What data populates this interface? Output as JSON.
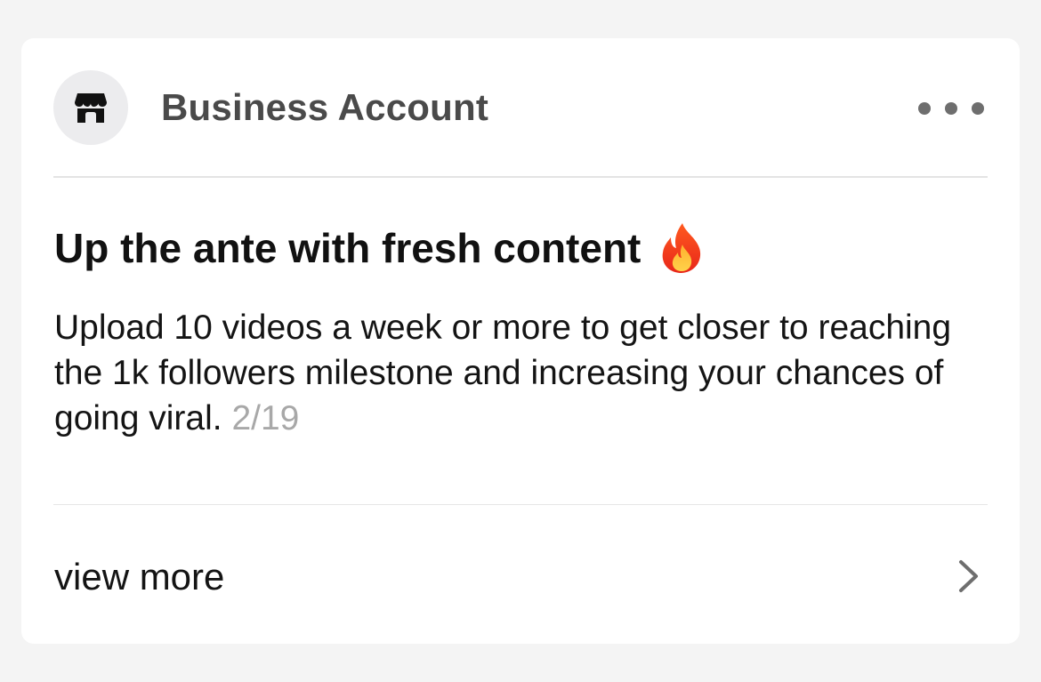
{
  "header": {
    "account_name": "Business Account",
    "avatar_icon": "storefront-icon",
    "more_icon": "more-horizontal-icon"
  },
  "content": {
    "title": "Up the ante with fresh content",
    "title_emoji": "fire-icon",
    "body": "Upload 10 videos a week or more to get closer to reaching the 1k followers milestone and increasing your chances of going viral.",
    "counter": "2/19"
  },
  "footer": {
    "view_more_label": "view more",
    "chevron_icon": "chevron-right-icon"
  },
  "colors": {
    "background": "#f4f4f4",
    "card": "#ffffff",
    "muted_text": "#a8a8a8",
    "header_text": "#4a4a4a"
  }
}
